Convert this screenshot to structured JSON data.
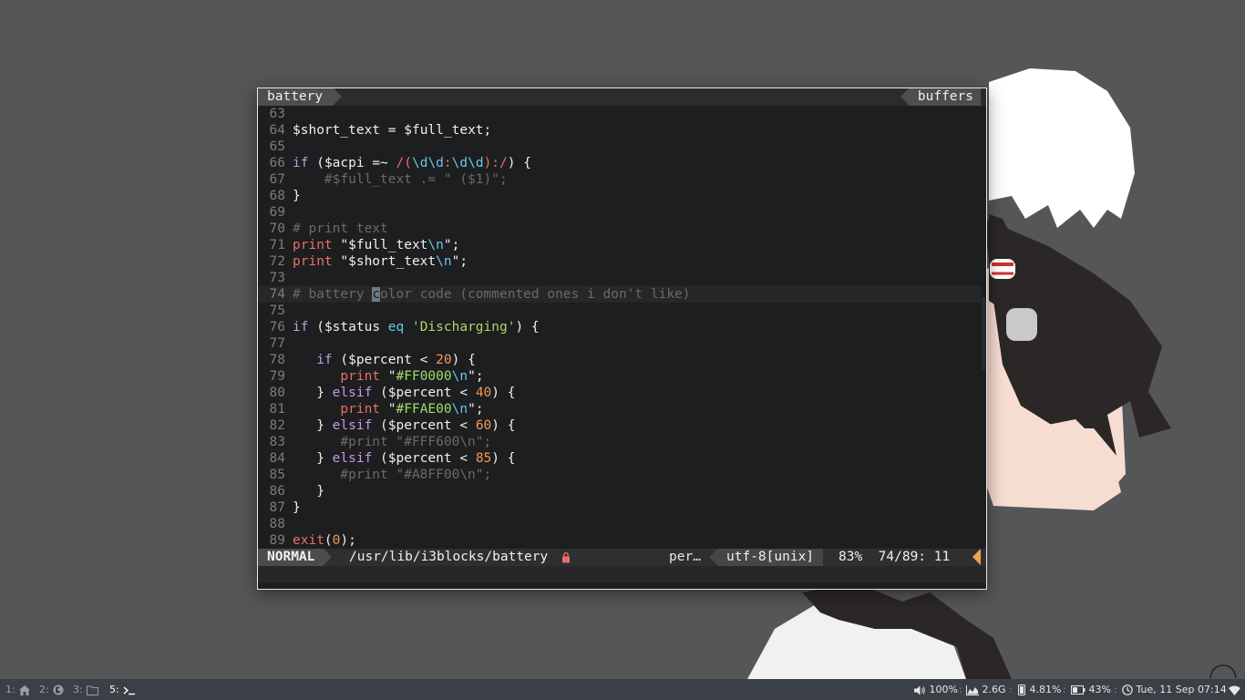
{
  "editor": {
    "buffer_name": "battery",
    "buffers_label": "buffers",
    "lines": [
      {
        "n": "63",
        "tokens": []
      },
      {
        "n": "64",
        "tokens": [
          [
            "c-var",
            "$short_text"
          ],
          [
            "c-var",
            " = "
          ],
          [
            "c-var",
            "$full_text"
          ],
          [
            "c-var",
            ";"
          ]
        ]
      },
      {
        "n": "65",
        "tokens": []
      },
      {
        "n": "66",
        "tokens": [
          [
            "c-kw",
            "if"
          ],
          [
            "c-var",
            " ("
          ],
          [
            "c-var",
            "$acpi"
          ],
          [
            "c-var",
            " =~ "
          ],
          [
            "c-re",
            "/("
          ],
          [
            "c-op",
            "\\d\\d"
          ],
          [
            "c-re",
            ":"
          ],
          [
            "c-op",
            "\\d\\d"
          ],
          [
            "c-re",
            "):/"
          ],
          [
            "c-var",
            ") {"
          ]
        ]
      },
      {
        "n": "67",
        "tokens": [
          [
            "c-cmt",
            "    #$full_text .= \" ($1)\";"
          ]
        ]
      },
      {
        "n": "68",
        "tokens": [
          [
            "c-var",
            "}"
          ]
        ]
      },
      {
        "n": "69",
        "tokens": []
      },
      {
        "n": "70",
        "tokens": [
          [
            "c-cmt",
            "# print text"
          ]
        ]
      },
      {
        "n": "71",
        "tokens": [
          [
            "c-fn",
            "print"
          ],
          [
            "c-var",
            " \"$full_text"
          ],
          [
            "c-esc",
            "\\n"
          ],
          [
            "c-var",
            "\";"
          ]
        ]
      },
      {
        "n": "72",
        "tokens": [
          [
            "c-fn",
            "print"
          ],
          [
            "c-var",
            " \"$short_text"
          ],
          [
            "c-esc",
            "\\n"
          ],
          [
            "c-var",
            "\";"
          ]
        ]
      },
      {
        "n": "73",
        "tokens": []
      },
      {
        "n": "74",
        "current": true,
        "tokens": [
          [
            "c-cmt",
            "# battery "
          ],
          [
            "cursor",
            "c"
          ],
          [
            "c-cmt",
            "olor code (commented ones i don't like)"
          ]
        ]
      },
      {
        "n": "75",
        "tokens": []
      },
      {
        "n": "76",
        "tokens": [
          [
            "c-kw",
            "if"
          ],
          [
            "c-var",
            " ("
          ],
          [
            "c-var",
            "$status"
          ],
          [
            "c-op",
            " eq "
          ],
          [
            "c-str",
            "'Discharging'"
          ],
          [
            "c-var",
            ") {"
          ]
        ]
      },
      {
        "n": "77",
        "tokens": []
      },
      {
        "n": "78",
        "tokens": [
          [
            "c-var",
            "   "
          ],
          [
            "c-kw",
            "if"
          ],
          [
            "c-var",
            " ($percent < "
          ],
          [
            "c-num",
            "20"
          ],
          [
            "c-var",
            ") {"
          ]
        ]
      },
      {
        "n": "79",
        "tokens": [
          [
            "c-var",
            "      "
          ],
          [
            "c-fn",
            "print"
          ],
          [
            "c-var",
            " \""
          ],
          [
            "c-str",
            "#FF0000"
          ],
          [
            "c-esc",
            "\\n"
          ],
          [
            "c-var",
            "\";"
          ]
        ]
      },
      {
        "n": "80",
        "tokens": [
          [
            "c-var",
            "   } "
          ],
          [
            "c-kw",
            "elsif"
          ],
          [
            "c-var",
            " ($percent < "
          ],
          [
            "c-num",
            "40"
          ],
          [
            "c-var",
            ") {"
          ]
        ]
      },
      {
        "n": "81",
        "tokens": [
          [
            "c-var",
            "      "
          ],
          [
            "c-fn",
            "print"
          ],
          [
            "c-var",
            " \""
          ],
          [
            "c-str",
            "#FFAE00"
          ],
          [
            "c-esc",
            "\\n"
          ],
          [
            "c-var",
            "\";"
          ]
        ]
      },
      {
        "n": "82",
        "tokens": [
          [
            "c-var",
            "   } "
          ],
          [
            "c-kw",
            "elsif"
          ],
          [
            "c-var",
            " ($percent < "
          ],
          [
            "c-num",
            "60"
          ],
          [
            "c-var",
            ") {"
          ]
        ]
      },
      {
        "n": "83",
        "tokens": [
          [
            "c-cmt",
            "      #print \"#FFF600\\n\";"
          ]
        ]
      },
      {
        "n": "84",
        "tokens": [
          [
            "c-var",
            "   } "
          ],
          [
            "c-kw",
            "elsif"
          ],
          [
            "c-var",
            " ($percent < "
          ],
          [
            "c-num",
            "85"
          ],
          [
            "c-var",
            ") {"
          ]
        ]
      },
      {
        "n": "85",
        "tokens": [
          [
            "c-cmt",
            "      #print \"#A8FF00\\n\";"
          ]
        ]
      },
      {
        "n": "86",
        "tokens": [
          [
            "c-var",
            "   }"
          ]
        ]
      },
      {
        "n": "87",
        "tokens": [
          [
            "c-var",
            "}"
          ]
        ]
      },
      {
        "n": "88",
        "tokens": []
      },
      {
        "n": "89",
        "tokens": [
          [
            "c-fn",
            "exit"
          ],
          [
            "c-var",
            "("
          ],
          [
            "c-num",
            "0"
          ],
          [
            "c-var",
            ");"
          ]
        ]
      }
    ],
    "status": {
      "mode": "NORMAL",
      "path": "/usr/lib/i3blocks/battery",
      "lock_icon": "lock-icon",
      "filetype": "per…",
      "encoding": "utf-8[unix]",
      "position": "83%  74/89: 11"
    }
  },
  "bar": {
    "workspaces": [
      {
        "num": "1:",
        "icon": "home-icon"
      },
      {
        "num": "2:",
        "icon": "firefox-icon"
      },
      {
        "num": "3:",
        "icon": "folder-icon"
      },
      {
        "num": "5:",
        "icon": "terminal-icon",
        "active": true
      }
    ],
    "volume": "100%",
    "memory": "2.6G",
    "cpu": "4.81%",
    "battery": "43%",
    "datetime": "Tue, 11 Sep 07:14"
  },
  "colors": {
    "desktop_bg": "#555657",
    "editor_bg": "#1d1e1f",
    "accent_orange": "#f0a04b"
  }
}
